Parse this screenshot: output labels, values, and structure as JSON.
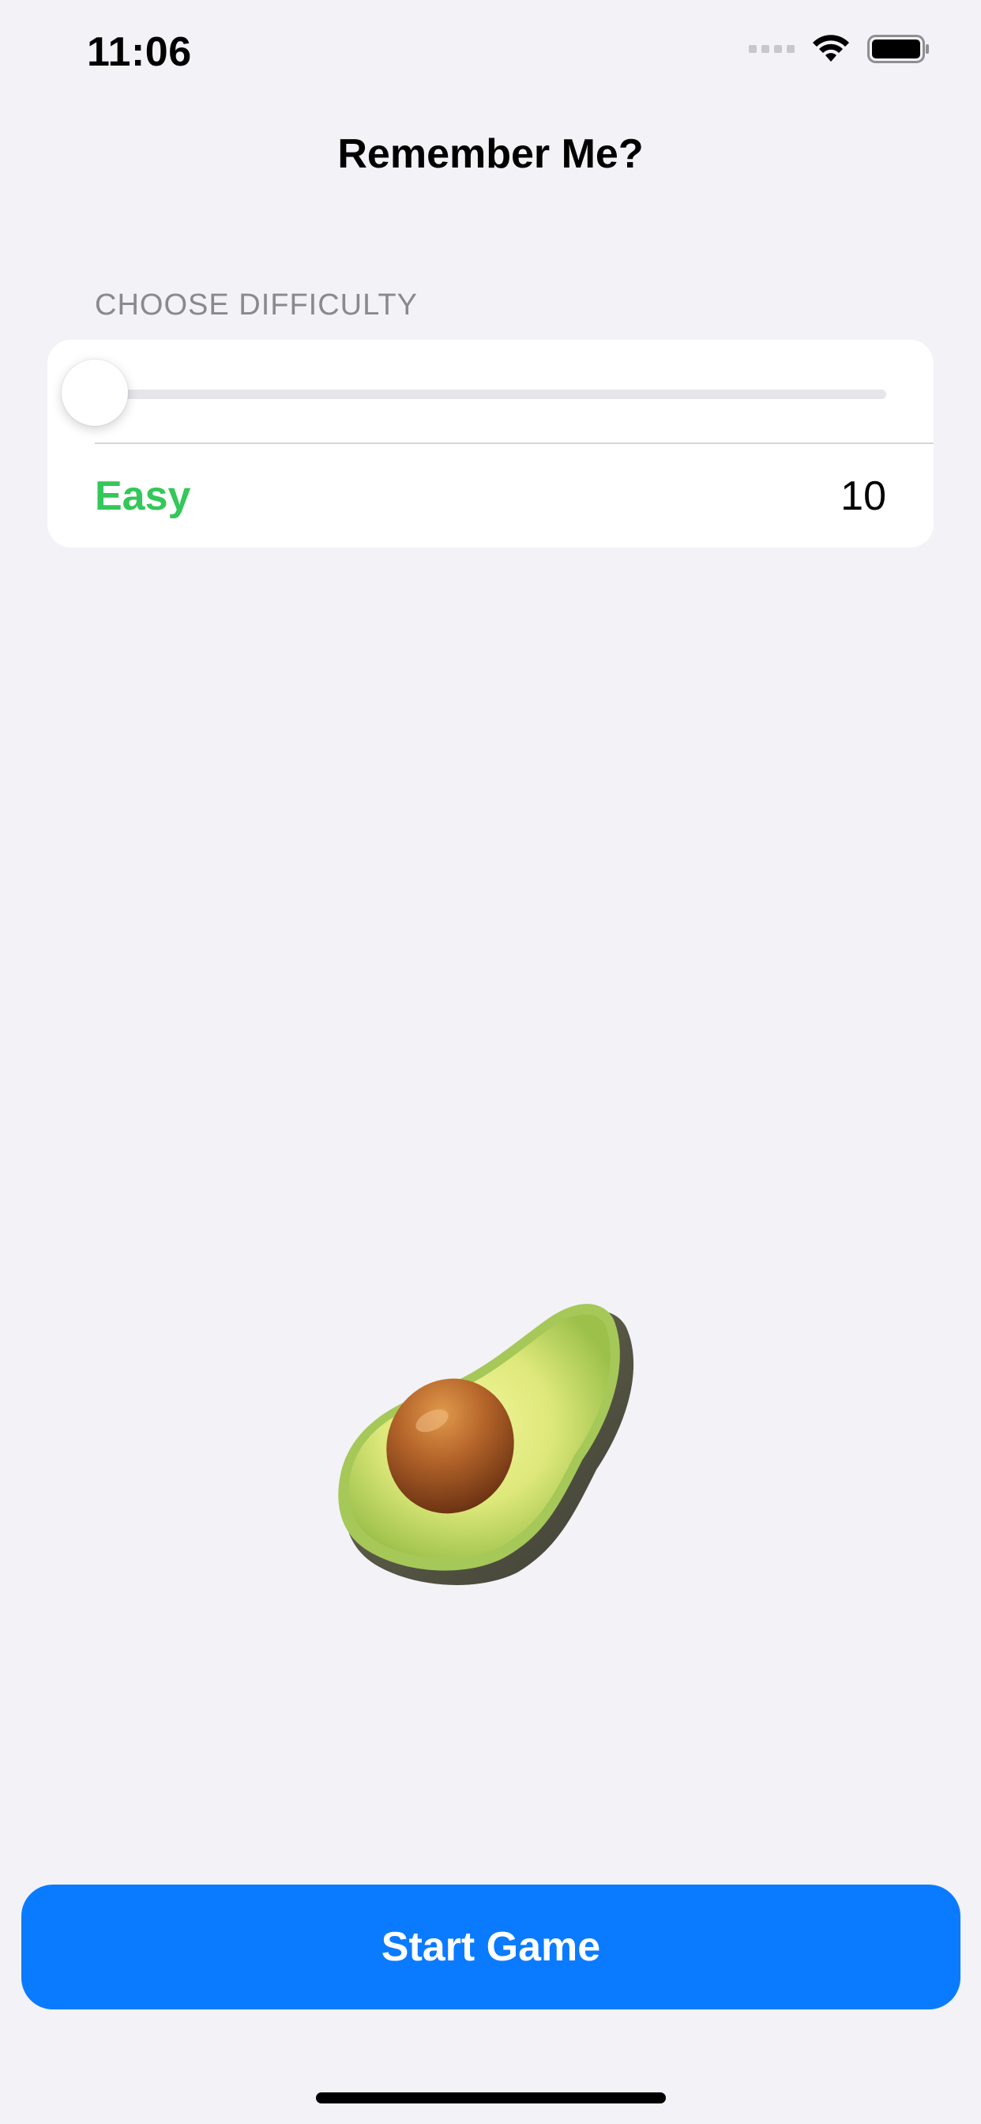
{
  "status_bar": {
    "time": "11:06",
    "icons": [
      "signal-dots-icon",
      "wifi-icon",
      "battery-icon"
    ]
  },
  "nav": {
    "title": "Remember Me?"
  },
  "difficulty": {
    "section_header": "CHOOSE DIFFICULTY",
    "slider_value": 0,
    "level_label": "Easy",
    "level_color": "#34C759",
    "count": "10"
  },
  "emoji": {
    "name": "avocado-icon"
  },
  "actions": {
    "start_label": "Start Game",
    "start_color": "#0A7BFF"
  }
}
